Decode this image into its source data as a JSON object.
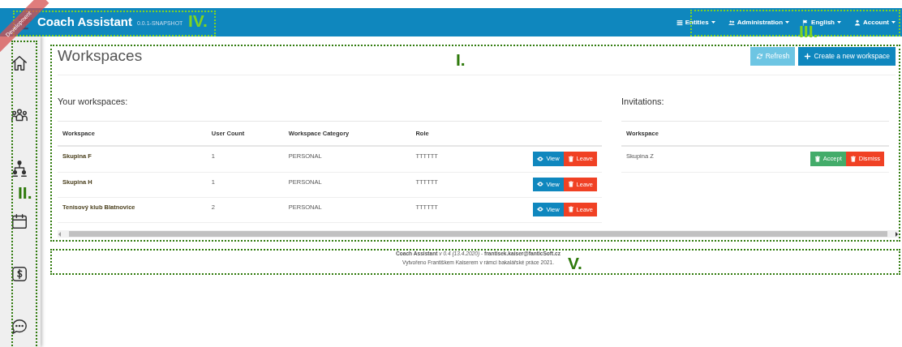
{
  "navbar": {
    "ribbon": "Development",
    "brand": "Coach Assistant",
    "version": "0.0.1-SNAPSHOT",
    "menus": [
      {
        "label": "Entities",
        "kind": "list"
      },
      {
        "label": "Administration",
        "kind": "users"
      },
      {
        "label": "English",
        "kind": "flag"
      },
      {
        "label": "Account",
        "kind": "user"
      }
    ]
  },
  "sidebar": {
    "items": [
      {
        "kind": "home"
      },
      {
        "kind": "group"
      },
      {
        "kind": "tree"
      },
      {
        "kind": "calendar"
      },
      {
        "kind": "dollar"
      },
      {
        "kind": "chat"
      }
    ]
  },
  "page": {
    "title": "Workspaces",
    "buttons": [
      {
        "label": "Refresh",
        "kind": "refresh",
        "disabled": true
      },
      {
        "label": "Create a new workspace",
        "kind": "plus",
        "disabled": false
      }
    ]
  },
  "workspaces": {
    "heading": "Your workspaces:",
    "columns": [
      "Workspace",
      "User Count",
      "Workspace Category",
      "Role"
    ],
    "rows": [
      {
        "cells": [
          "Skupina F",
          "1",
          "PERSONAL",
          "TTTTTT"
        ],
        "actions": [
          "View",
          "Leave"
        ]
      },
      {
        "cells": [
          "Skupina H",
          "1",
          "PERSONAL",
          "TTTTTT"
        ],
        "actions": [
          "View",
          "Leave"
        ]
      },
      {
        "cells": [
          "Tenisový klub Blatnovice",
          "2",
          "PERSONAL",
          "TTTTTT"
        ],
        "actions": [
          "View",
          "Leave"
        ]
      }
    ]
  },
  "invitations": {
    "heading": "Invitations:",
    "columns": [
      "Workspace"
    ],
    "rows": [
      {
        "cells": [
          "Skupina Z"
        ],
        "actions": [
          "Accept",
          "Dismiss"
        ]
      }
    ]
  },
  "footer": {
    "lines": [
      "**Coach Assistant** *v 0.4 (13.4.2020)* - **frantisek.kaiser@fanticSoft.cz**",
      "Vytvořeno Františkem Kaiserem v rámci bakalářské práce 2021."
    ]
  },
  "annotations": [
    {
      "label": "I.",
      "color": "#2f7a0c"
    },
    {
      "label": "II.",
      "color": "#2f7a0c"
    },
    {
      "label": "III.",
      "color": "#7ed321"
    },
    {
      "label": "IV.",
      "color": "#7ed321"
    },
    {
      "label": "V.",
      "color": "#2f7a0c"
    }
  ]
}
